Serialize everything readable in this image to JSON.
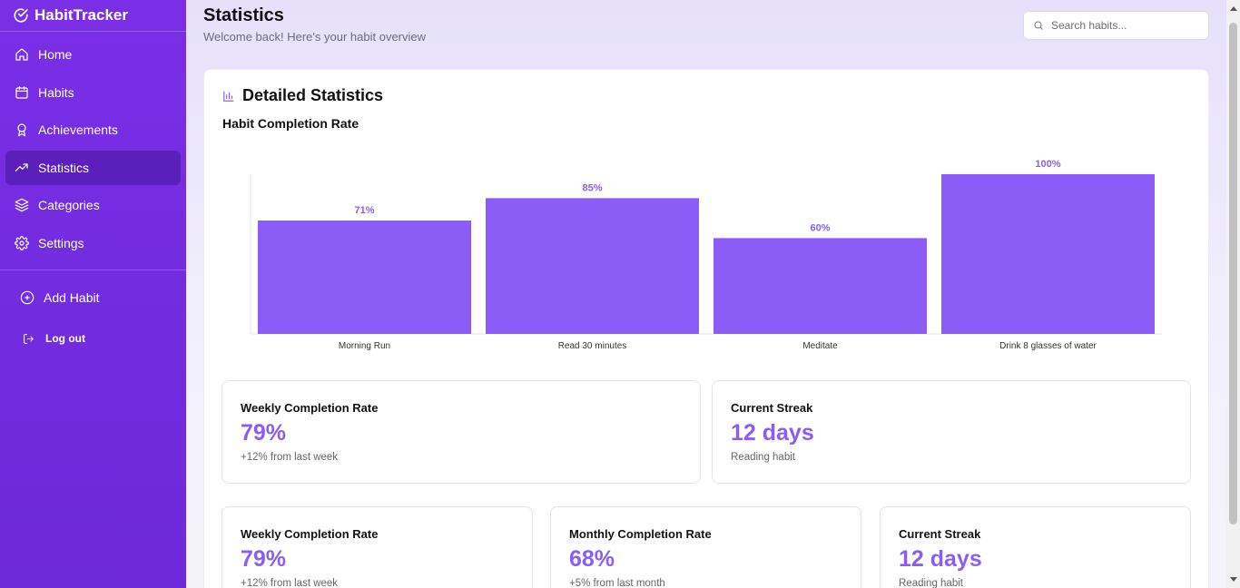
{
  "brand": {
    "name": "HabitTracker"
  },
  "sidebar": {
    "items": [
      {
        "label": "Home",
        "icon": "home-icon"
      },
      {
        "label": "Habits",
        "icon": "calendar-icon"
      },
      {
        "label": "Achievements",
        "icon": "award-icon"
      },
      {
        "label": "Statistics",
        "icon": "trending-up-icon",
        "active": true
      },
      {
        "label": "Categories",
        "icon": "layers-icon"
      },
      {
        "label": "Settings",
        "icon": "gear-icon"
      }
    ],
    "add_habit": "Add Habit",
    "logout": "Log out"
  },
  "header": {
    "title": "Statistics",
    "subtitle": "Welcome back! Here's your habit overview"
  },
  "search": {
    "placeholder": "Search habits..."
  },
  "card": {
    "title": "Detailed Statistics",
    "chart_title": "Habit Completion Rate"
  },
  "chart_data": {
    "type": "bar",
    "categories": [
      "Morning Run",
      "Read 30 minutes",
      "Meditate",
      "Drink 8 glasses of water"
    ],
    "values": [
      71,
      85,
      60,
      100
    ],
    "value_labels": [
      "71%",
      "85%",
      "60%",
      "100%"
    ],
    "title": "Habit Completion Rate",
    "ylim": [
      0,
      100
    ],
    "color": "#8b5cf6"
  },
  "stats_row1": [
    {
      "label": "Weekly Completion Rate",
      "value": "79%",
      "note": "+12% from last week"
    },
    {
      "label": "Current Streak",
      "value": "12 days",
      "note": "Reading habit"
    }
  ],
  "stats_row2": [
    {
      "label": "Weekly Completion Rate",
      "value": "79%",
      "note": "+12% from last week"
    },
    {
      "label": "Monthly Completion Rate",
      "value": "68%",
      "note": "+5% from last month"
    },
    {
      "label": "Current Streak",
      "value": "12 days",
      "note": "Reading habit"
    }
  ],
  "colors": {
    "sidebar": "#7a2fe6",
    "accent": "#8b5cf6"
  }
}
